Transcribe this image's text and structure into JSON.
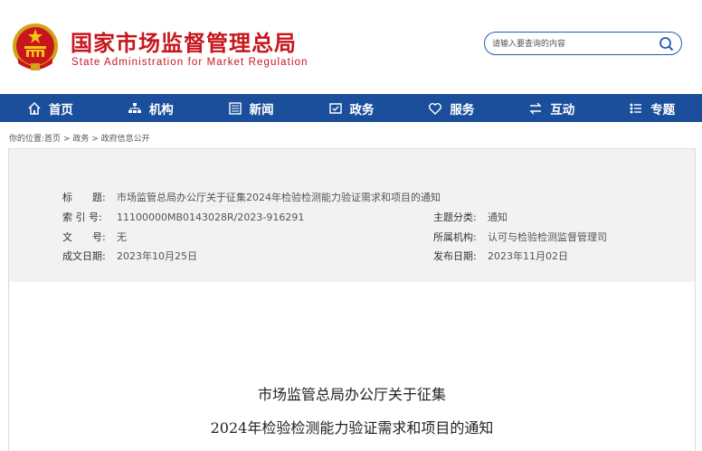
{
  "header": {
    "title_cn": "国家市场监督管理总局",
    "title_en": "State Administration for Market Regulation",
    "search_placeholder": "请输入要查询的内容"
  },
  "nav": {
    "items": [
      {
        "label": "首页",
        "icon": "home-icon"
      },
      {
        "label": "机构",
        "icon": "org-icon"
      },
      {
        "label": "新闻",
        "icon": "news-icon"
      },
      {
        "label": "政务",
        "icon": "affairs-icon"
      },
      {
        "label": "服务",
        "icon": "service-icon"
      },
      {
        "label": "互动",
        "icon": "interact-icon"
      },
      {
        "label": "专题",
        "icon": "topic-icon"
      }
    ]
  },
  "breadcrumb": {
    "prefix": "你的位置:",
    "items": [
      "首页",
      "政务",
      "政府信息公开"
    ],
    "sep": " > "
  },
  "meta": {
    "title_label": "标　　题:",
    "title_value": "市场监管总局办公厅关于征集2024年检验检测能力验证需求和项目的通知",
    "index_label": "索 引 号:",
    "index_value": "11100000MB0143028R/2023-916291",
    "category_label": "主题分类:",
    "category_value": "通知",
    "docno_label": "文　　号:",
    "docno_value": "无",
    "org_label": "所属机构:",
    "org_value": "认可与检验检测监督管理司",
    "date_label": "成文日期:",
    "date_value": "2023年10月25日",
    "pub_label": "发布日期:",
    "pub_value": "2023年11月02日"
  },
  "document": {
    "title_line1": "市场监管总局办公厅关于征集",
    "title_line2": "2024年检验检测能力验证需求和项目的通知"
  },
  "colors": {
    "brand_red": "#c8161d",
    "nav_blue": "#1b4f9c"
  }
}
